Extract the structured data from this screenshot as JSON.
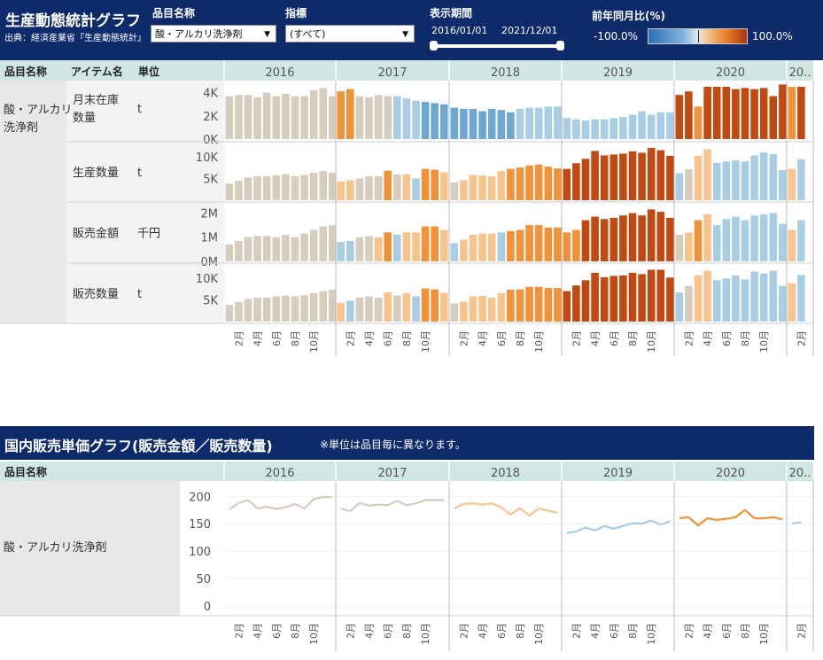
{
  "header": {
    "title": "生産動態統計グラフ",
    "source": "出典：経済産業省『生産動態統計』",
    "filters": [
      {
        "label": "品目名称",
        "value": "酸・アルカリ洗浄剤"
      },
      {
        "label": "指標",
        "value": "(すべて)"
      }
    ],
    "period": {
      "label": "表示期間",
      "start": "2016/01/01",
      "end": "2021/12/01"
    },
    "legend": {
      "label": "前年同月比(%)",
      "min": "-100.0%",
      "max": "100.0%"
    }
  },
  "bottom_header": {
    "title": "国内販売単価グラフ(販売金額／販売数量)",
    "note": "※単位は品目毎に異なります。"
  },
  "colors": {
    "navy": "#0d2a6b",
    "teal_header": "#cfe6e3",
    "row_gray": "#e8e8e8",
    "neutral": "#d6cdbf",
    "light_blue": "#a9cde3",
    "blue": "#6fa7d3",
    "light_orange": "#f6c48c",
    "orange": "#f0923a",
    "dark_orange": "#c04a12"
  },
  "chart_data": [
    {
      "type": "bar",
      "title": "生産動態統計グラフ",
      "columns": [
        "品目名称",
        "アイテム名",
        "単位"
      ],
      "item": "酸・アルカリ洗浄剤",
      "years": [
        "2016",
        "2017",
        "2018",
        "2019",
        "2020",
        "20.."
      ],
      "month_ticks": [
        "2月",
        "4月",
        "6月",
        "8月",
        "10月"
      ],
      "color_scale": {
        "measure": "前年同月比(%)",
        "min": -100,
        "max": 100
      },
      "panels": [
        {
          "name": "月末在庫数量",
          "unit": "t",
          "ylim": [
            0,
            4500
          ],
          "yticks": [
            0,
            2000,
            4000
          ],
          "ytick_labels": [
            "0K",
            "2K",
            "4K"
          ],
          "values": [
            [
              3700,
              3800,
              3800,
              3600,
              4000,
              3700,
              3900,
              3700,
              3700,
              4200,
              4400,
              3700
            ],
            [
              4100,
              4300,
              3700,
              3600,
              3800,
              3700,
              3700,
              3500,
              3300,
              3200,
              3100,
              3000
            ],
            [
              2700,
              2600,
              2600,
              2400,
              2600,
              2500,
              2300,
              2600,
              2700,
              2700,
              2800,
              2800
            ],
            [
              1800,
              1700,
              1600,
              1700,
              1700,
              1800,
              1900,
              2100,
              2400,
              2100,
              2300,
              2300
            ],
            [
              3800,
              4100,
              2800,
              4500,
              4500,
              4500,
              4300,
              4400,
              4300,
              4400,
              3700,
              4700
            ],
            [
              4500,
              4500
            ]
          ],
          "colors": [
            [
              "n",
              "n",
              "n",
              "n",
              "n",
              "n",
              "n",
              "n",
              "n",
              "n",
              "n",
              "n"
            ],
            [
              "o",
              "o",
              "n",
              "n",
              "n",
              "n",
              "lb",
              "lb",
              "lb",
              "b",
              "b",
              "b"
            ],
            [
              "b",
              "b",
              "b",
              "b",
              "b",
              "b",
              "b",
              "lb",
              "lb",
              "lb",
              "lb",
              "lb"
            ],
            [
              "lb",
              "lb",
              "lb",
              "lb",
              "lb",
              "lb",
              "lb",
              "lb",
              "lb",
              "lb",
              "lb",
              "lb"
            ],
            [
              "do",
              "do",
              "o",
              "do",
              "do",
              "do",
              "do",
              "do",
              "do",
              "do",
              "do",
              "do"
            ],
            [
              "o",
              "do"
            ]
          ]
        },
        {
          "name": "生産数量",
          "unit": "t",
          "ylim": [
            0,
            12000
          ],
          "yticks": [
            5000,
            10000
          ],
          "ytick_labels": [
            "5K",
            "10K"
          ],
          "values": [
            [
              3800,
              4500,
              5200,
              5500,
              5500,
              5700,
              6000,
              5500,
              5800,
              6300,
              6700,
              6300
            ],
            [
              4300,
              4600,
              5000,
              5500,
              5500,
              6800,
              5900,
              6000,
              5000,
              7200,
              7000,
              6400
            ],
            [
              4100,
              4600,
              5800,
              5700,
              5500,
              6700,
              7200,
              7500,
              8000,
              8200,
              7700,
              7300
            ],
            [
              7200,
              8500,
              9500,
              11300,
              10300,
              10500,
              10700,
              11200,
              10900,
              12000,
              11500,
              10200
            ],
            [
              6200,
              7100,
              10200,
              11700,
              8600,
              8900,
              9200,
              8900,
              10300,
              11000,
              10600,
              6900
            ],
            [
              7200,
              9400
            ]
          ],
          "colors": [
            [
              "n",
              "n",
              "n",
              "n",
              "n",
              "n",
              "n",
              "n",
              "n",
              "n",
              "n",
              "n"
            ],
            [
              "lo",
              "lo",
              "n",
              "n",
              "n",
              "o",
              "n",
              "lo",
              "lb",
              "o",
              "o",
              "lo"
            ],
            [
              "n",
              "lo",
              "lo",
              "lo",
              "lo",
              "lo",
              "o",
              "o",
              "o",
              "o",
              "o",
              "o"
            ],
            [
              "do",
              "do",
              "do",
              "do",
              "do",
              "do",
              "do",
              "do",
              "do",
              "do",
              "do",
              "do"
            ],
            [
              "lb",
              "n",
              "lo",
              "lo",
              "lb",
              "lb",
              "lb",
              "lb",
              "lb",
              "lb",
              "lb",
              "lb"
            ],
            [
              "lo",
              "lb"
            ]
          ]
        },
        {
          "name": "販売金額",
          "unit": "千円",
          "ylim": [
            0,
            2200000
          ],
          "yticks": [
            0,
            1000000,
            2000000
          ],
          "ytick_labels": [
            "0M",
            "1M",
            "2M"
          ],
          "values": [
            [
              700000,
              850000,
              1000000,
              1050000,
              1050000,
              1000000,
              1100000,
              1000000,
              1150000,
              1300000,
              1450000,
              1500000
            ],
            [
              800000,
              850000,
              1000000,
              1050000,
              1000000,
              1200000,
              1100000,
              1200000,
              1200000,
              1450000,
              1450000,
              1300000
            ],
            [
              750000,
              900000,
              1100000,
              1150000,
              1150000,
              1200000,
              1250000,
              1300000,
              1500000,
              1500000,
              1400000,
              1400000
            ],
            [
              1200000,
              1300000,
              1700000,
              1850000,
              1750000,
              1800000,
              1900000,
              2000000,
              1900000,
              2150000,
              2050000,
              1800000
            ],
            [
              1100000,
              1200000,
              1700000,
              1950000,
              1500000,
              1750000,
              1850000,
              1700000,
              1900000,
              1950000,
              2000000,
              1550000
            ],
            [
              1300000,
              1700000
            ]
          ],
          "colors": [
            [
              "n",
              "n",
              "n",
              "n",
              "n",
              "n",
              "n",
              "n",
              "n",
              "n",
              "n",
              "n"
            ],
            [
              "lb",
              "lb",
              "n",
              "n",
              "lo",
              "o",
              "lb",
              "lo",
              "lo",
              "o",
              "o",
              "lo"
            ],
            [
              "lb",
              "lo",
              "lo",
              "lo",
              "lo",
              "lb",
              "o",
              "o",
              "o",
              "o",
              "o",
              "o"
            ],
            [
              "o",
              "o",
              "do",
              "do",
              "do",
              "do",
              "do",
              "do",
              "do",
              "do",
              "do",
              "do"
            ],
            [
              "n",
              "lo",
              "o",
              "lo",
              "lb",
              "lb",
              "lb",
              "lb",
              "lb",
              "lb",
              "lb",
              "lb"
            ],
            [
              "lo",
              "lb"
            ]
          ]
        },
        {
          "name": "販売数量",
          "unit": "t",
          "ylim": [
            0,
            12000
          ],
          "yticks": [
            5000,
            10000
          ],
          "ytick_labels": [
            "5K",
            "10K"
          ],
          "values": [
            [
              3800,
              4500,
              5200,
              5500,
              5500,
              5800,
              6000,
              5800,
              6000,
              6500,
              7000,
              7300
            ],
            [
              4300,
              4800,
              5500,
              5800,
              5500,
              6700,
              6000,
              6500,
              5800,
              7600,
              7400,
              6600
            ],
            [
              4200,
              4600,
              5800,
              5900,
              5500,
              6500,
              7300,
              7400,
              8000,
              8000,
              7700,
              7700
            ],
            [
              7000,
              8300,
              9500,
              11200,
              10200,
              10500,
              10600,
              11200,
              10900,
              11900,
              11900,
              10100
            ],
            [
              6700,
              8200,
              10600,
              11700,
              9500,
              9900,
              10600,
              9700,
              11500,
              11000,
              11700,
              8200
            ],
            [
              8800,
              10700
            ]
          ],
          "colors": [
            [
              "n",
              "n",
              "n",
              "n",
              "n",
              "n",
              "n",
              "n",
              "n",
              "n",
              "n",
              "n"
            ],
            [
              "lo",
              "lb",
              "n",
              "n",
              "n",
              "lo",
              "n",
              "lo",
              "lb",
              "o",
              "o",
              "lo"
            ],
            [
              "n",
              "lo",
              "lo",
              "lo",
              "lo",
              "lo",
              "o",
              "o",
              "o",
              "o",
              "o",
              "o"
            ],
            [
              "do",
              "do",
              "do",
              "do",
              "do",
              "do",
              "do",
              "do",
              "do",
              "do",
              "do",
              "do"
            ],
            [
              "lb",
              "n",
              "lo",
              "lo",
              "lb",
              "lb",
              "lb",
              "lb",
              "lb",
              "lb",
              "lb",
              "lb"
            ],
            [
              "lo",
              "lb"
            ]
          ]
        }
      ]
    },
    {
      "type": "line",
      "title": "国内販売単価グラフ(販売金額／販売数量)",
      "columns": [
        "品目名称"
      ],
      "item": "酸・アルカリ洗浄剤",
      "years": [
        "2016",
        "2017",
        "2018",
        "2019",
        "2020",
        "20.."
      ],
      "month_ticks": [
        "2月",
        "4月",
        "6月",
        "8月",
        "10月"
      ],
      "ylim": [
        0,
        215
      ],
      "yticks": [
        0,
        50,
        100,
        150,
        200
      ],
      "series_values": [
        [
          176,
          188,
          193,
          178,
          181,
          177,
          180,
          186,
          178,
          195,
          199,
          198
        ],
        [
          178,
          173,
          188,
          183,
          185,
          184,
          192,
          184,
          187,
          193,
          193,
          193
        ],
        [
          178,
          186,
          187,
          185,
          187,
          180,
          167,
          178,
          165,
          178,
          174,
          170
        ],
        [
          133,
          136,
          143,
          138,
          146,
          141,
          146,
          151,
          150,
          156,
          148,
          155
        ],
        [
          160,
          162,
          147,
          160,
          157,
          159,
          162,
          175,
          160,
          160,
          162,
          158
        ],
        [
          150,
          153
        ]
      ],
      "series_colors": [
        "n",
        "n",
        "lo",
        "lb",
        "o",
        "lb"
      ]
    }
  ]
}
